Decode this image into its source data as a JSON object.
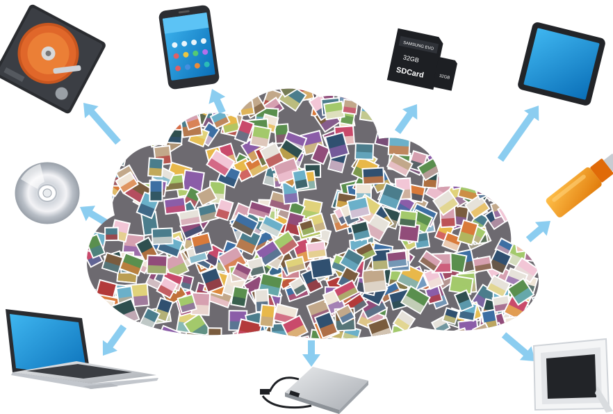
{
  "scene": {
    "description_free": true,
    "background": "#ffffff",
    "arrow_color": "#7ec8ee",
    "sd_card": {
      "brand_top": "SAMSUNG EVO",
      "capacity": "32GB",
      "label": "SDCard",
      "micro_capacity": "32GB"
    }
  },
  "devices": [
    {
      "name": "hard-drive-icon"
    },
    {
      "name": "smartphone-icon"
    },
    {
      "name": "sd-card-icon"
    },
    {
      "name": "tablet-icon"
    },
    {
      "name": "cd-disc-icon"
    },
    {
      "name": "usb-flash-drive-icon"
    },
    {
      "name": "laptop-icon"
    },
    {
      "name": "external-hdd-icon"
    },
    {
      "name": "digital-photo-frame-icon"
    }
  ],
  "colors": {
    "arrow": "#7ec8ee",
    "screen_blue": "#1e9be0",
    "usb_orange": "#f39a1c",
    "hdd_platter": "#e0672a"
  }
}
